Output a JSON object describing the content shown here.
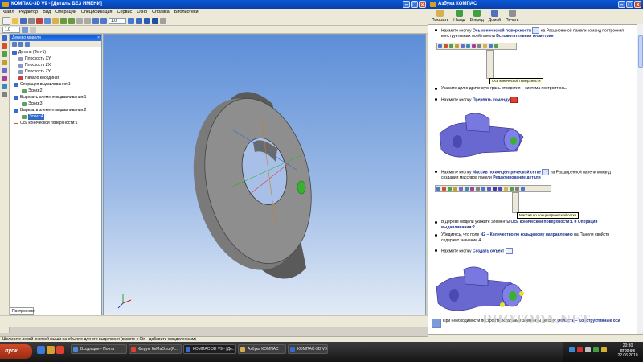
{
  "kompas": {
    "title": "КОМПАС-3D V9 - [Деталь БЕЗ ИМЕНИ]",
    "menu": [
      "Файл",
      "Редактор",
      "Вид",
      "Операции",
      "Спецификация",
      "Сервис",
      "Окно",
      "Справка",
      "Библиотеки"
    ],
    "zoom_value": "1.0",
    "scale_value": "1.0",
    "tree_title": "Дерево модели",
    "tree": [
      "Деталь (Тел-1)",
      "Плоскость XY",
      "Плоскость ZX",
      "Плоскость ZY",
      "Начало координат",
      "Операция выдавливания:1",
      "Эскиз:2",
      "Вырезать элемент выдавливания:1",
      "Эскиз:3",
      "Вырезать элемент выдавливания:2",
      "Эскиз:4",
      "Ось конической поверхности:1"
    ],
    "tab_label": "Построение",
    "status": "Щелкните левой кнопкой мыши на объекте для его выделения (вместе с Ctrl - добавить к выделенным)"
  },
  "help": {
    "title": "Азбука КОМПАС",
    "nav": [
      "Показать",
      "Назад",
      "Вперед",
      "Домой",
      "Печать"
    ],
    "step1_pre": "Нажмите кнопку ",
    "step1_bold": "Ось конической поверхности",
    "step1_mid": " на Расширенной панели команд построения конструктивных осей панели ",
    "step1_bold2": "Вспомогательная геометрия",
    "tooltip1": "Ось конической поверхности",
    "step2": "Укажите цилиндрическую грань отверстия – система построит ось.",
    "step3_pre": "Нажмите кнопку ",
    "step3_bold": "Прервать команду",
    "step4_pre": "Нажмите кнопку ",
    "step4_bold": "Массив по концентрической сетке",
    "step4_mid": " на Расширенной панели команд создания массивов панели ",
    "step4_bold2": "Редактирование детали",
    "tooltip2": "Массив по концентрической сетке",
    "step5_pre": "В Дереве модели укажите элементы ",
    "step5_bold": "Ось конической поверхности:1 и Операция выдавливания:2",
    "step6_pre": "Убедитесь, что поле ",
    "step6_bold": "N2 – Количество по кольцевому направлению",
    "step6_post": " на Панели свойств содержит значение 4",
    "step7_pre": "Нажмите кнопку ",
    "step7_bold": "Создать объект",
    "step8_pre": "При необходимости постройте остальные элементы детали: ",
    "step8_bold": "Область – Конструктивные оси"
  },
  "watermark": "PHOTODA.NET",
  "taskbar": {
    "start": "пуск",
    "tasks": [
      "Входящие - Почта",
      "Форум КиМаО.ru (F...",
      "КОМПАС-3D V9 - [Де...",
      "Азбука КОМПАС",
      "КОМПАС-3D V9"
    ],
    "clock_time": "20:30",
    "clock_day": "вторник",
    "clock_date": "22.06.2010"
  },
  "colors": {
    "title_blue": "#0a3fa8",
    "part_gray": "#8a8a8a",
    "part_blue": "#6a6ad8",
    "accent_green": "#3ab030"
  }
}
